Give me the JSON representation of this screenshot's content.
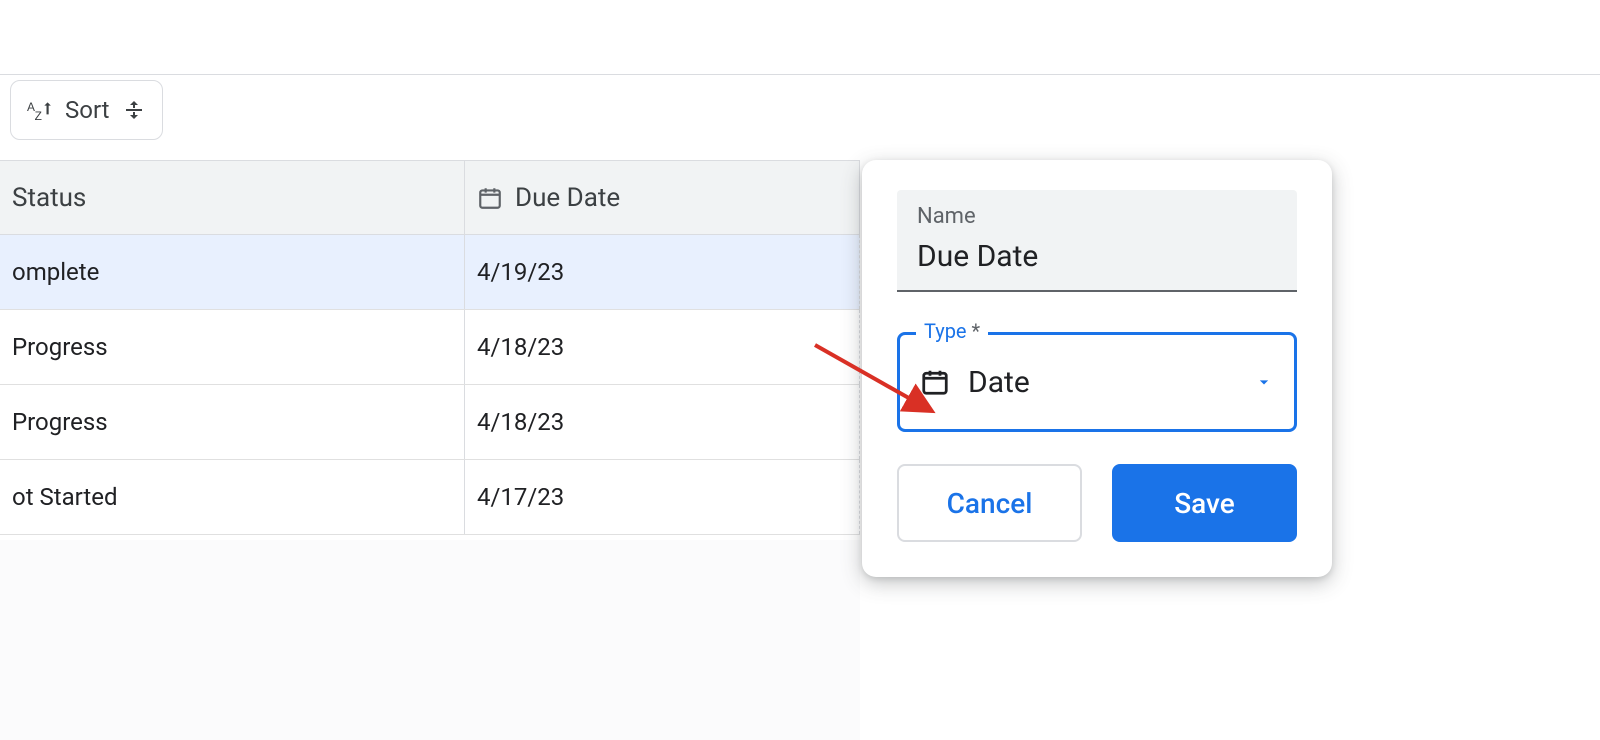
{
  "toolbar": {
    "sort_label": "Sort"
  },
  "table": {
    "columns": {
      "status": "Status",
      "due_date": "Due Date"
    },
    "rows": [
      {
        "status": "omplete",
        "due_date": "4/19/23",
        "selected": true
      },
      {
        "status": "Progress",
        "due_date": "4/18/23",
        "selected": false
      },
      {
        "status": "Progress",
        "due_date": "4/18/23",
        "selected": false
      },
      {
        "status": "ot Started",
        "due_date": "4/17/23",
        "selected": false
      }
    ]
  },
  "popover": {
    "name_label": "Name",
    "name_value": "Due Date",
    "type_label": "Type",
    "type_required_mark": "*",
    "type_value": "Date",
    "cancel": "Cancel",
    "save": "Save"
  }
}
